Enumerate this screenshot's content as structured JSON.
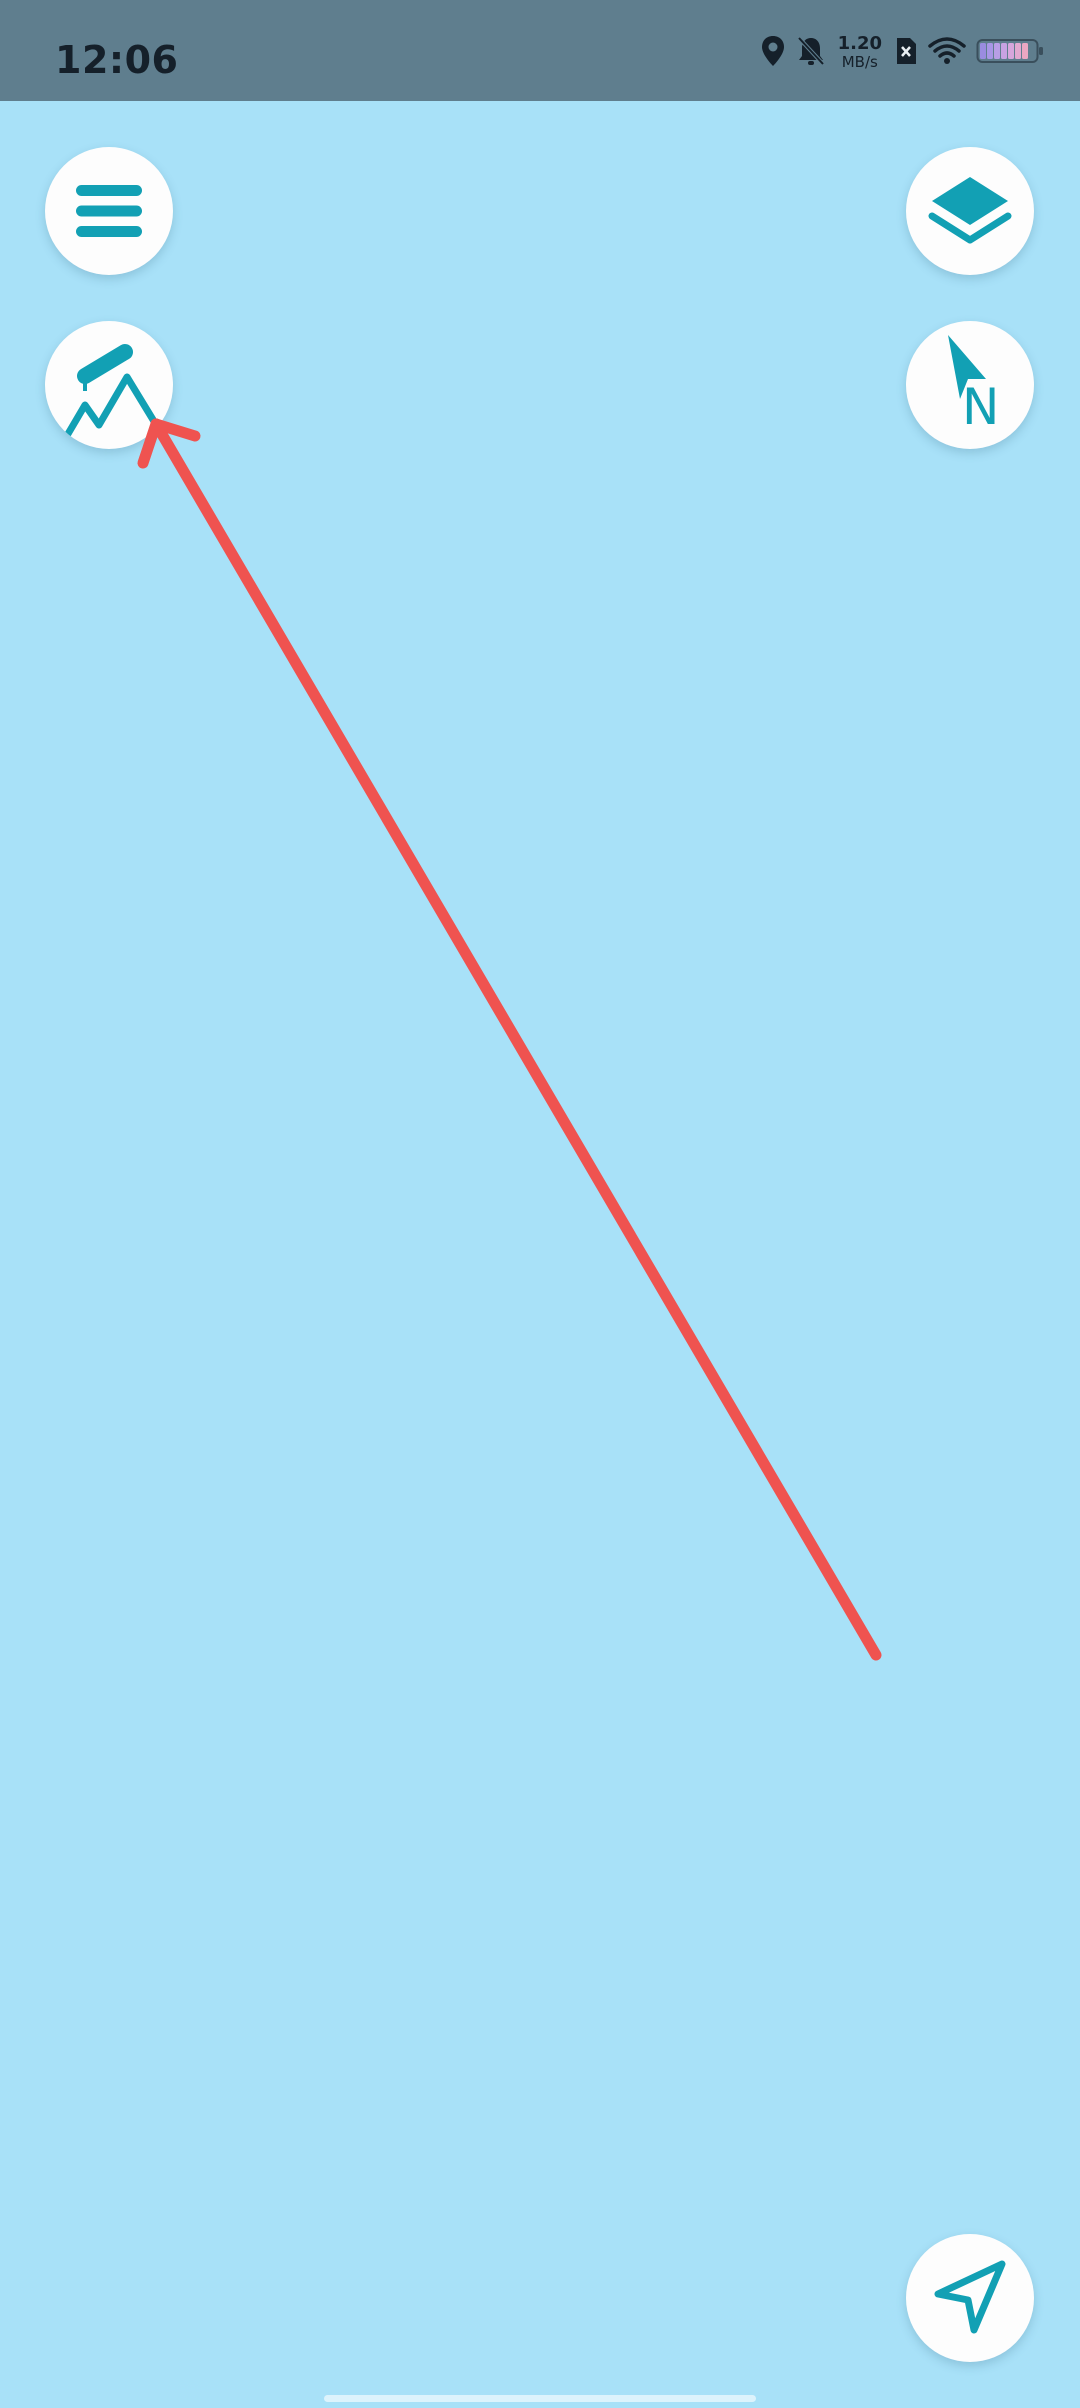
{
  "status_bar": {
    "time": "12:06",
    "network_speed_value": "1.20",
    "network_speed_unit": "MB/s",
    "icons": [
      "location-icon",
      "bell-muted-icon",
      "sim-x-icon",
      "wifi-icon",
      "battery-icon"
    ]
  },
  "map_controls": {
    "menu_icon": "hamburger-menu-icon",
    "layers_icon": "layers-icon",
    "logo_icon": "mountain-cable-car-icon",
    "compass_icon": "north-compass-icon",
    "compass_label": "N",
    "locate_icon": "navigation-arrow-icon"
  },
  "colors": {
    "map_background": "#a8e1f8",
    "status_bar": "#5f7e8e",
    "accent": "#12a0b4",
    "annotation_arrow": "#ef5350",
    "button_fill": "#fdfdfd"
  }
}
